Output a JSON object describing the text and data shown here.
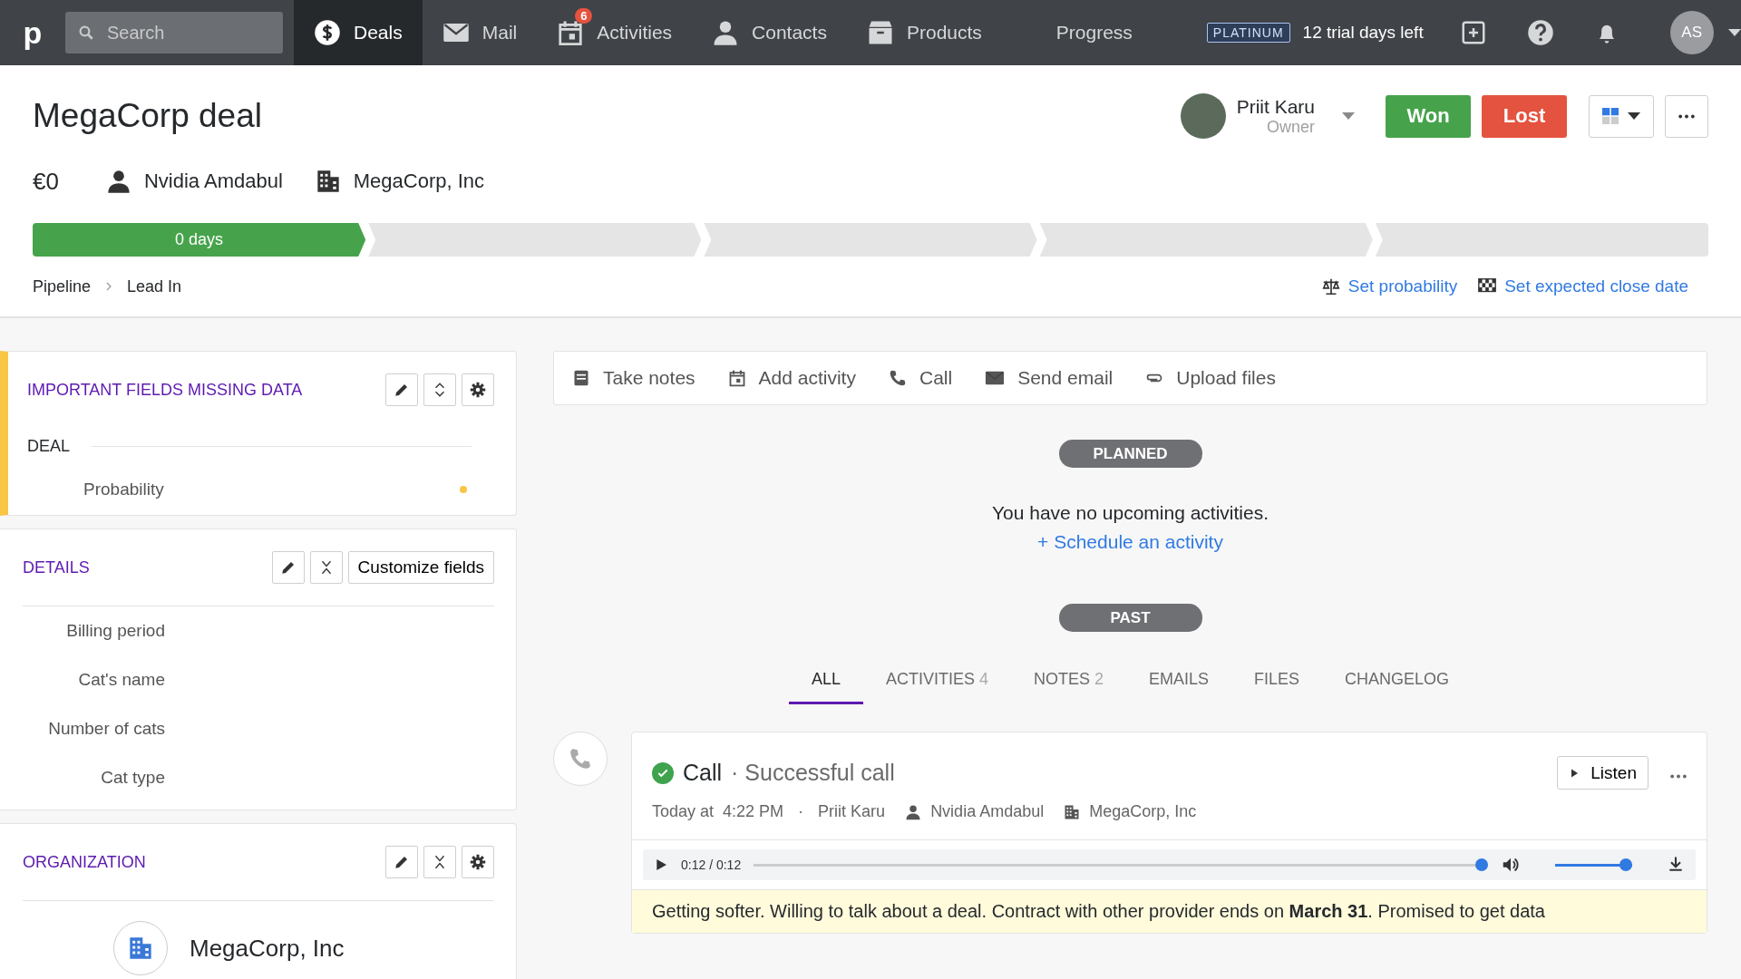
{
  "topbar": {
    "logo": "p",
    "search": {
      "placeholder": "Search"
    },
    "nav": [
      {
        "kind": "dollar",
        "label": "Deals",
        "selected": true
      },
      {
        "kind": "mail",
        "label": "Mail",
        "selected": false
      },
      {
        "kind": "calendar",
        "label": "Activities",
        "selected": false,
        "badge": "6"
      },
      {
        "kind": "person",
        "label": "Contacts",
        "selected": false
      },
      {
        "kind": "box",
        "label": "Products",
        "selected": false
      },
      {
        "kind": "plain",
        "label": "Progress",
        "selected": false
      }
    ],
    "plan": "PLATINUM",
    "trial": "12 trial days left",
    "avatar": "AS"
  },
  "deal": {
    "title": "MegaCorp deal",
    "value": "€0",
    "person": "Nvidia Amdabul",
    "organization": "MegaCorp, Inc",
    "owner": {
      "name": "Priit Karu",
      "role": "Owner"
    },
    "actions": [
      {
        "kind": "won",
        "label": "Won"
      },
      {
        "kind": "lost",
        "label": "Lost"
      }
    ]
  },
  "pipeline": {
    "stages": [
      {
        "label": "0 days",
        "reached": true
      },
      {
        "reached": false
      },
      {
        "reached": false
      },
      {
        "reached": false
      },
      {
        "reached": false
      }
    ],
    "breadcrumb": [
      "Pipeline",
      "Lead In"
    ],
    "links": [
      {
        "kind": "probability",
        "label": "Set probability"
      },
      {
        "kind": "close_date",
        "label": "Set expected close date"
      }
    ]
  },
  "important": {
    "title": "IMPORTANT FIELDS MISSING DATA",
    "section": "DEAL",
    "fields": [
      {
        "label": "Probability",
        "missing": true
      }
    ]
  },
  "details": {
    "title": "DETAILS",
    "button": "Customize fields",
    "fields": [
      "Billing period",
      "Cat's name",
      "Number of cats",
      "Cat type"
    ]
  },
  "organization": {
    "title": "ORGANIZATION",
    "name": "MegaCorp, Inc"
  },
  "composer": [
    {
      "kind": "notes",
      "label": "Take notes"
    },
    {
      "kind": "activity",
      "label": "Add activity"
    },
    {
      "kind": "call",
      "label": "Call"
    },
    {
      "kind": "email",
      "label": "Send email"
    },
    {
      "kind": "files",
      "label": "Upload files"
    }
  ],
  "planned": {
    "label": "PLANNED",
    "message": "You have no upcoming activities.",
    "link": "+ Schedule an activity"
  },
  "past": {
    "label": "PAST",
    "filters": [
      {
        "label": "ALL",
        "selected": true
      },
      {
        "label": "ACTIVITIES",
        "count": "4",
        "selected": false
      },
      {
        "label": "NOTES",
        "count": "2",
        "selected": false
      },
      {
        "label": "EMAILS",
        "selected": false
      },
      {
        "label": "FILES",
        "selected": false
      },
      {
        "label": "CHANGELOG",
        "selected": false
      }
    ]
  },
  "activity": {
    "done": true,
    "type": "Call",
    "subject": "· Successful call",
    "listen": "Listen",
    "date": "Today at",
    "time": "4:22 PM",
    "separator": "·",
    "owner": "Priit Karu",
    "person": "Nvidia Amdabul",
    "organization": "MegaCorp, Inc",
    "player": {
      "time": "0:12 / 0:12",
      "progress": {
        "level": 1
      },
      "volume": {
        "level": 1
      }
    },
    "note": "Getting softer. Willing to talk about a deal. Contract with other provider ends on **March 31**. Promised to get data"
  }
}
